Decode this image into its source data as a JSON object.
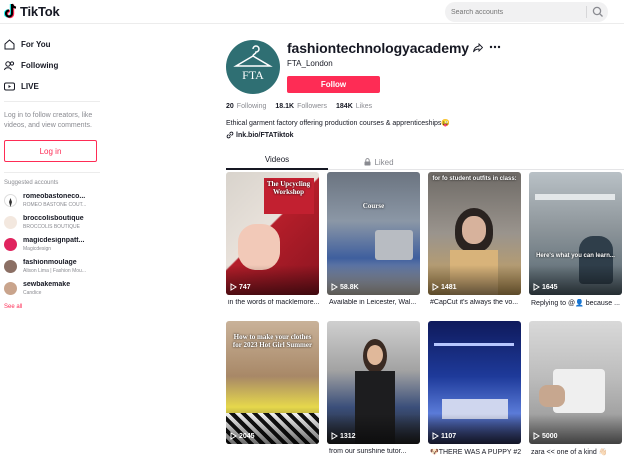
{
  "header": {
    "logo_text": "TikTok",
    "search_placeholder": "Search accounts"
  },
  "sidebar": {
    "nav": [
      {
        "label": "For You",
        "icon": "home-icon"
      },
      {
        "label": "Following",
        "icon": "people-icon"
      },
      {
        "label": "LIVE",
        "icon": "live-icon"
      }
    ],
    "login_message": "Log in to follow creators, like videos, and view comments.",
    "login_button": "Log in",
    "suggested_title": "Suggested accounts",
    "accounts": [
      {
        "name": "romeobastoneco...",
        "sub": "ROMEO BASTONE COUT..."
      },
      {
        "name": "broccolisboutique",
        "sub": "BROCCOLIS BOUTIQUE"
      },
      {
        "name": "magicdesignpatt...",
        "sub": "Magicdesign"
      },
      {
        "name": "fashionmoulage",
        "sub": "Alison Lima | Fashion Mou..."
      },
      {
        "name": "sewbakemake",
        "sub": "Candice"
      }
    ],
    "see_all": "See all"
  },
  "profile": {
    "avatar_text": "FTA",
    "username": "fashiontechnologyacademy",
    "nickname": "FTA_London",
    "follow_button": "Follow",
    "following_count": "20",
    "following_label": "Following",
    "followers_count": "18.1K",
    "followers_label": "Followers",
    "likes_count": "184K",
    "likes_label": "Likes",
    "bio": "Ethical garment factory offering production courses & apprenticeships😜",
    "link": "lnk.bio/FTATiktok"
  },
  "tabs": {
    "videos": "Videos",
    "liked": "Liked"
  },
  "videos": [
    {
      "views": "747",
      "caption": "in the words of macklemore...",
      "thumb_text": "The Upcycling Workshop"
    },
    {
      "views": "58.8K",
      "caption": "Available in Leicester, Wal...",
      "thumb_text": "Course"
    },
    {
      "views": "1481",
      "caption": "#CapCut it's always the vo...",
      "thumb_text": "for fo student outfits in class:"
    },
    {
      "views": "1645",
      "caption": "Replying to @👤 because ...",
      "thumb_text": "Here's what you can learn..."
    },
    {
      "views": "2045",
      "caption": "",
      "thumb_text": "How to make your clothes for 2023 Hot Girl Summer"
    },
    {
      "views": "1312",
      "caption": "from our sunshine tutor... ",
      "thumb_text": ""
    },
    {
      "views": "1107",
      "caption": "🐶THERE WAS A PUPPY #2",
      "thumb_text": ""
    },
    {
      "views": "5000",
      "caption": "zara << one of a kind 👋🏻",
      "thumb_text": ""
    }
  ],
  "colors": {
    "accent": "#fe2c55",
    "avatar_bg": "#2f6f73"
  }
}
